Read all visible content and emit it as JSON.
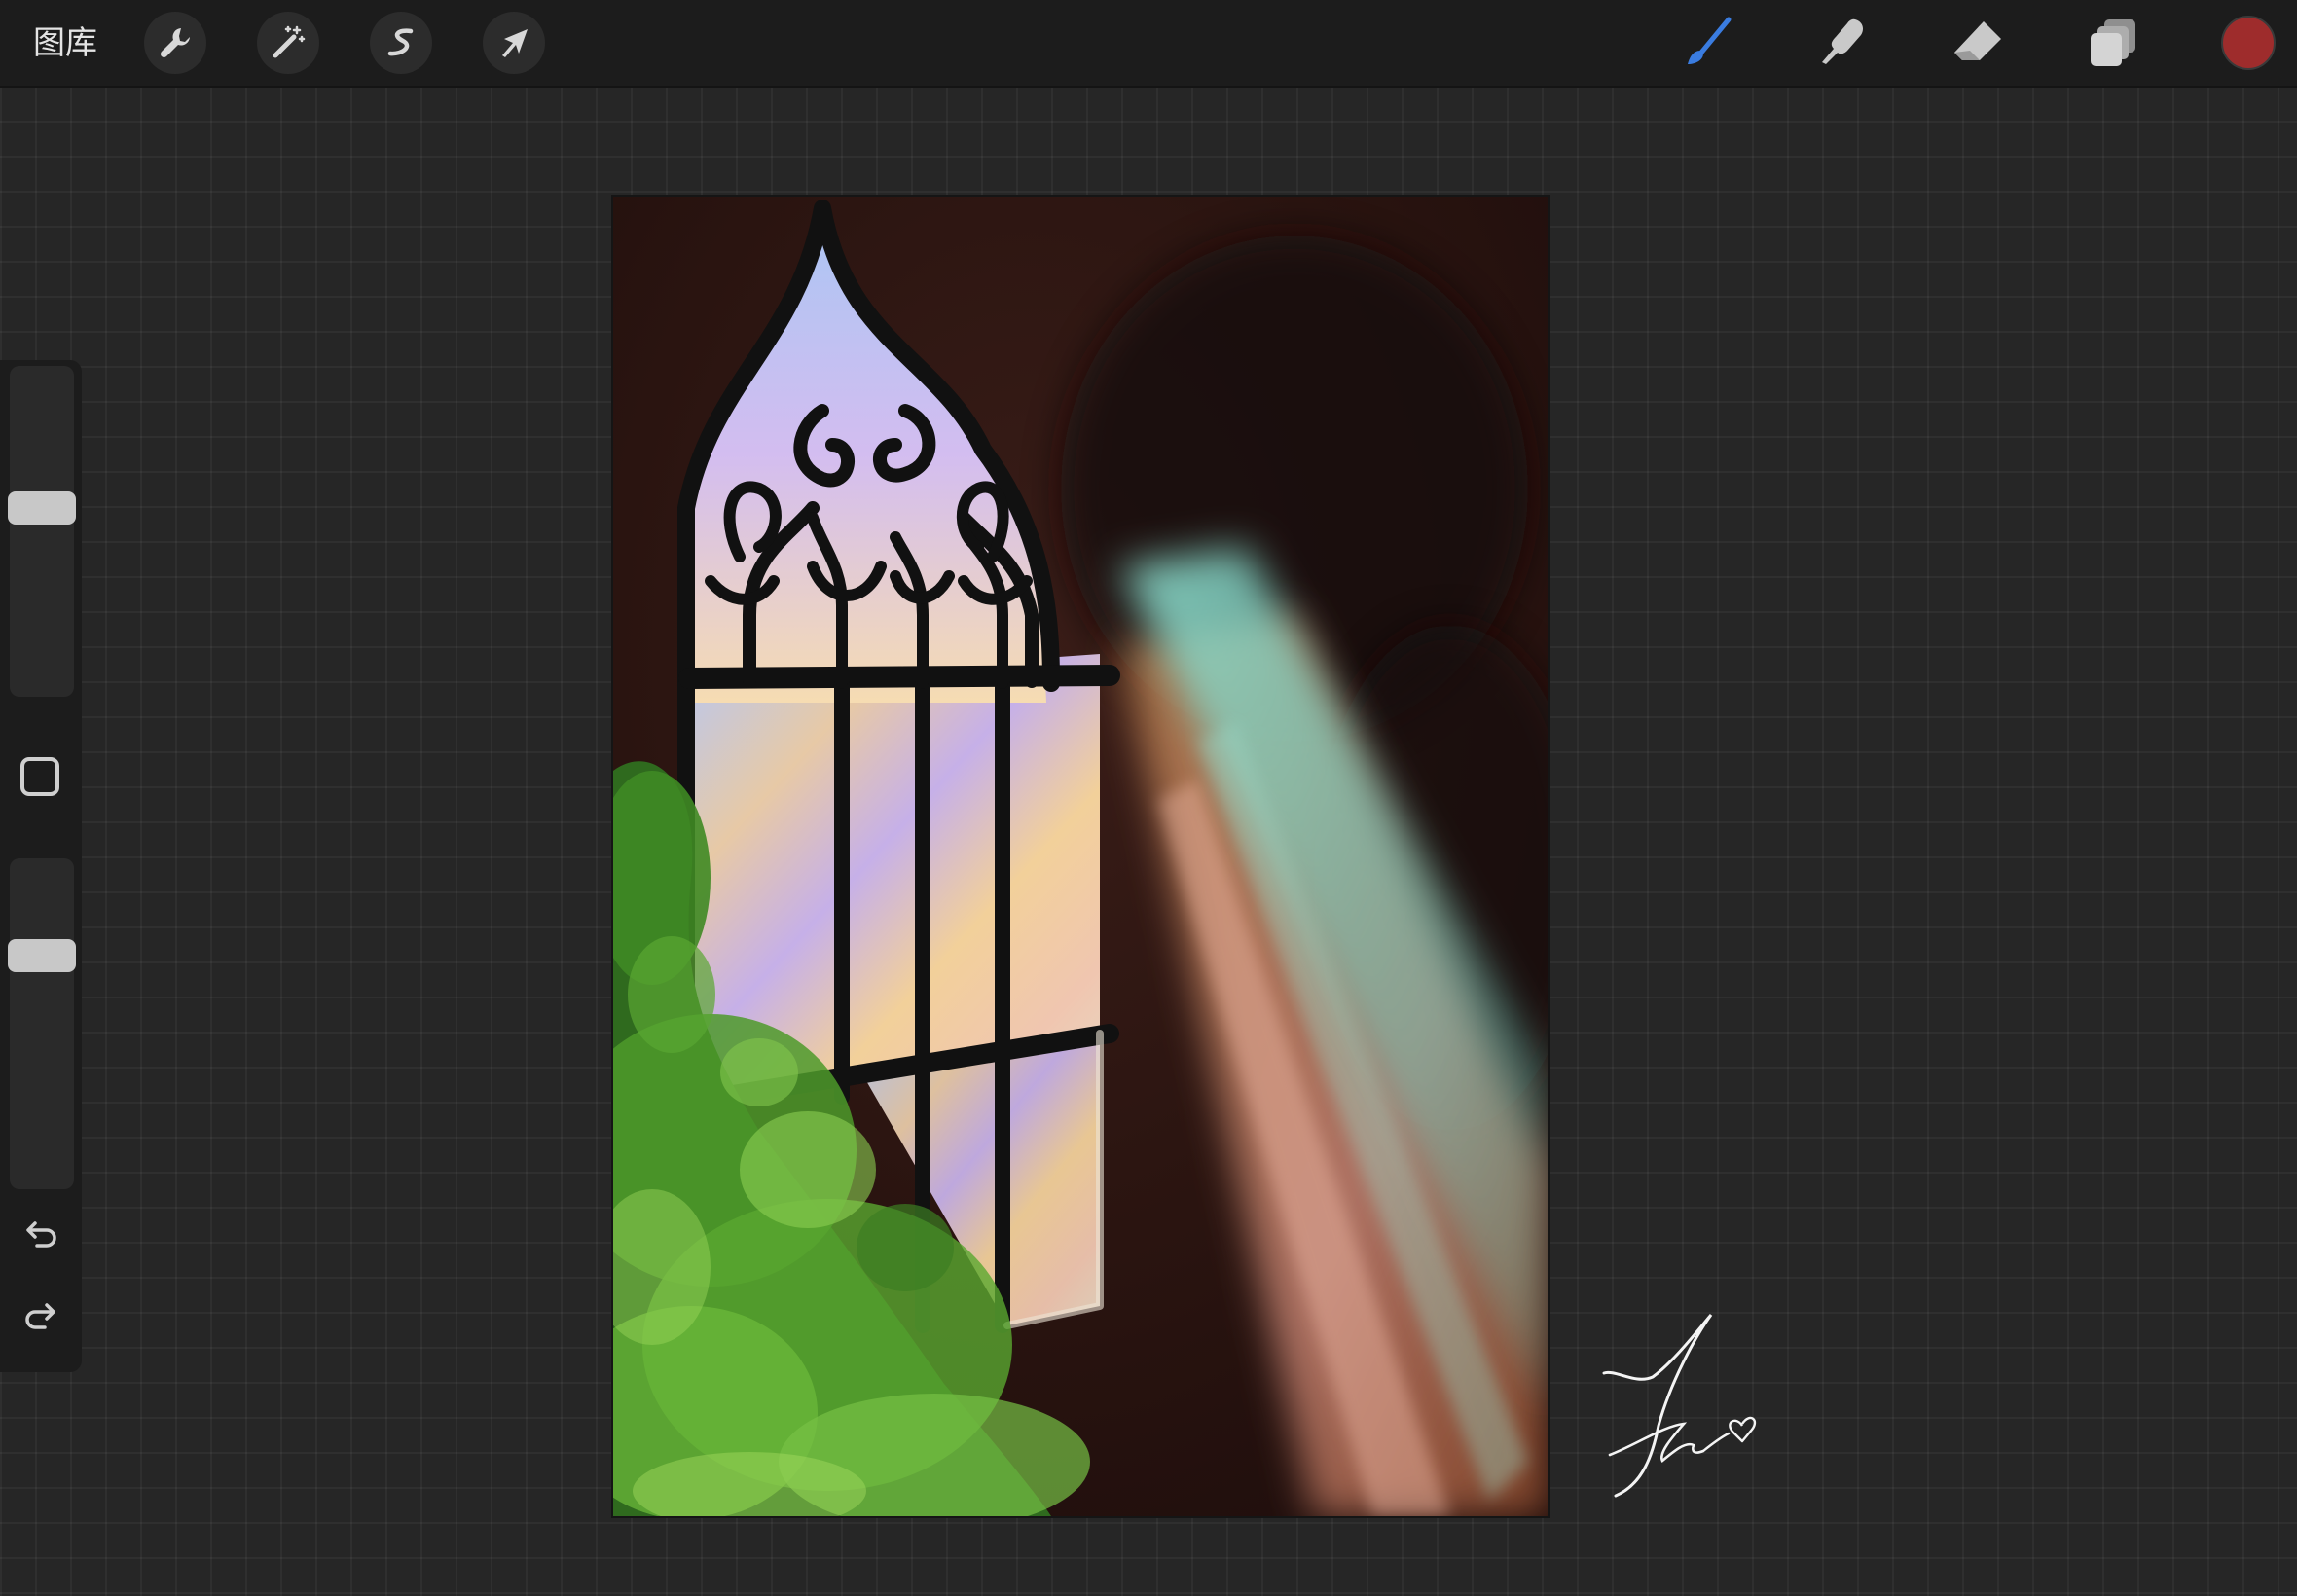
{
  "toolbar": {
    "gallery_label": "图库",
    "left_tools": [
      {
        "name": "actions",
        "icon": "wrench-icon"
      },
      {
        "name": "adjustments",
        "icon": "magic-wand-icon"
      },
      {
        "name": "selection",
        "icon": "selection-s-icon"
      },
      {
        "name": "transform",
        "icon": "arrow-cursor-icon"
      }
    ],
    "right_tools": [
      {
        "name": "brush",
        "icon": "brush-icon",
        "active": true
      },
      {
        "name": "smudge",
        "icon": "smudge-finger-icon",
        "active": false
      },
      {
        "name": "eraser",
        "icon": "eraser-icon",
        "active": false
      },
      {
        "name": "layers",
        "icon": "layers-icon",
        "active": false
      }
    ],
    "current_color": "#9e2c2c",
    "active_color": "#3a7ce0"
  },
  "sidebar": {
    "brush_size_level": 0.58,
    "opacity_level": 0.73,
    "modify_button_icon": "square-outline-icon",
    "undo_icon": "undo-icon",
    "redo_icon": "redo-icon"
  },
  "canvas": {
    "artwork": "gothic-stained-glass-window-painting",
    "signature": "handwritten-signature-with-heart"
  }
}
